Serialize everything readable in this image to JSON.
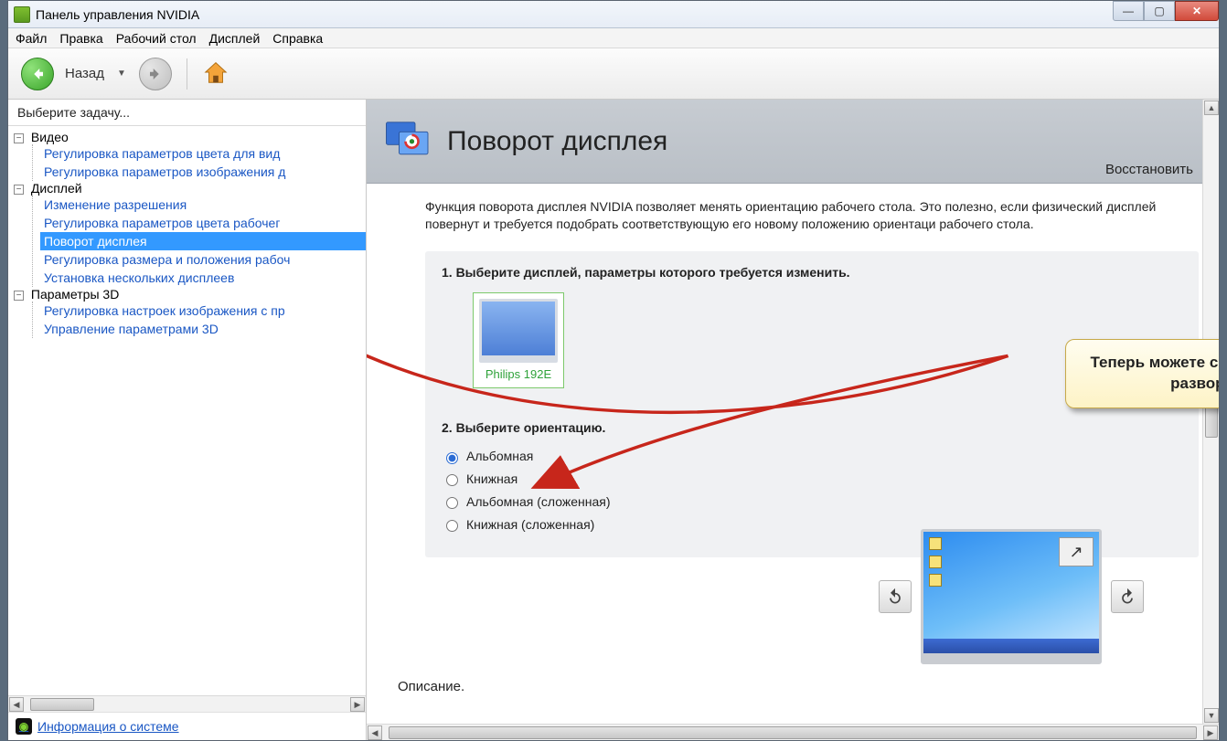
{
  "window": {
    "title": "Панель управления NVIDIA"
  },
  "menu": {
    "items": [
      "Файл",
      "Правка",
      "Рабочий стол",
      "Дисплей",
      "Справка"
    ]
  },
  "toolbar": {
    "back_label": "Назад"
  },
  "sidebar": {
    "title": "Выберите задачу...",
    "groups": [
      {
        "label": "Видео",
        "items": [
          "Регулировка параметров цвета для вид",
          "Регулировка параметров изображения д"
        ]
      },
      {
        "label": "Дисплей",
        "items": [
          "Изменение разрешения",
          "Регулировка параметров цвета рабочег",
          "Поворот дисплея",
          "Регулировка размера и положения рабоч",
          "Установка нескольких дисплеев"
        ]
      },
      {
        "label": "Параметры 3D",
        "items": [
          "Регулировка настроек изображения с пр",
          "Управление параметрами 3D"
        ]
      }
    ],
    "sysinfo": "Информация о системе"
  },
  "page": {
    "title": "Поворот дисплея",
    "restore": "Восстановить",
    "description": "Функция поворота дисплея NVIDIA позволяет менять ориентацию рабочего стола. Это полезно, если физический дисплей повернут и требуется подобрать соответствующую его новому положению ориентаци рабочего стола.",
    "step1_title": "1. Выберите дисплей, параметры которого требуется изменить.",
    "display_name": "Philips 192E",
    "step2_title": "2. Выберите ориентацию.",
    "orientations": [
      "Альбомная",
      "Книжная",
      "Альбомная (сложенная)",
      "Книжная (сложенная)"
    ],
    "selected_orientation": 0,
    "footer": "Описание."
  },
  "callout": {
    "text": "Теперь можете с легкостью выполнить разворот десплея!"
  }
}
